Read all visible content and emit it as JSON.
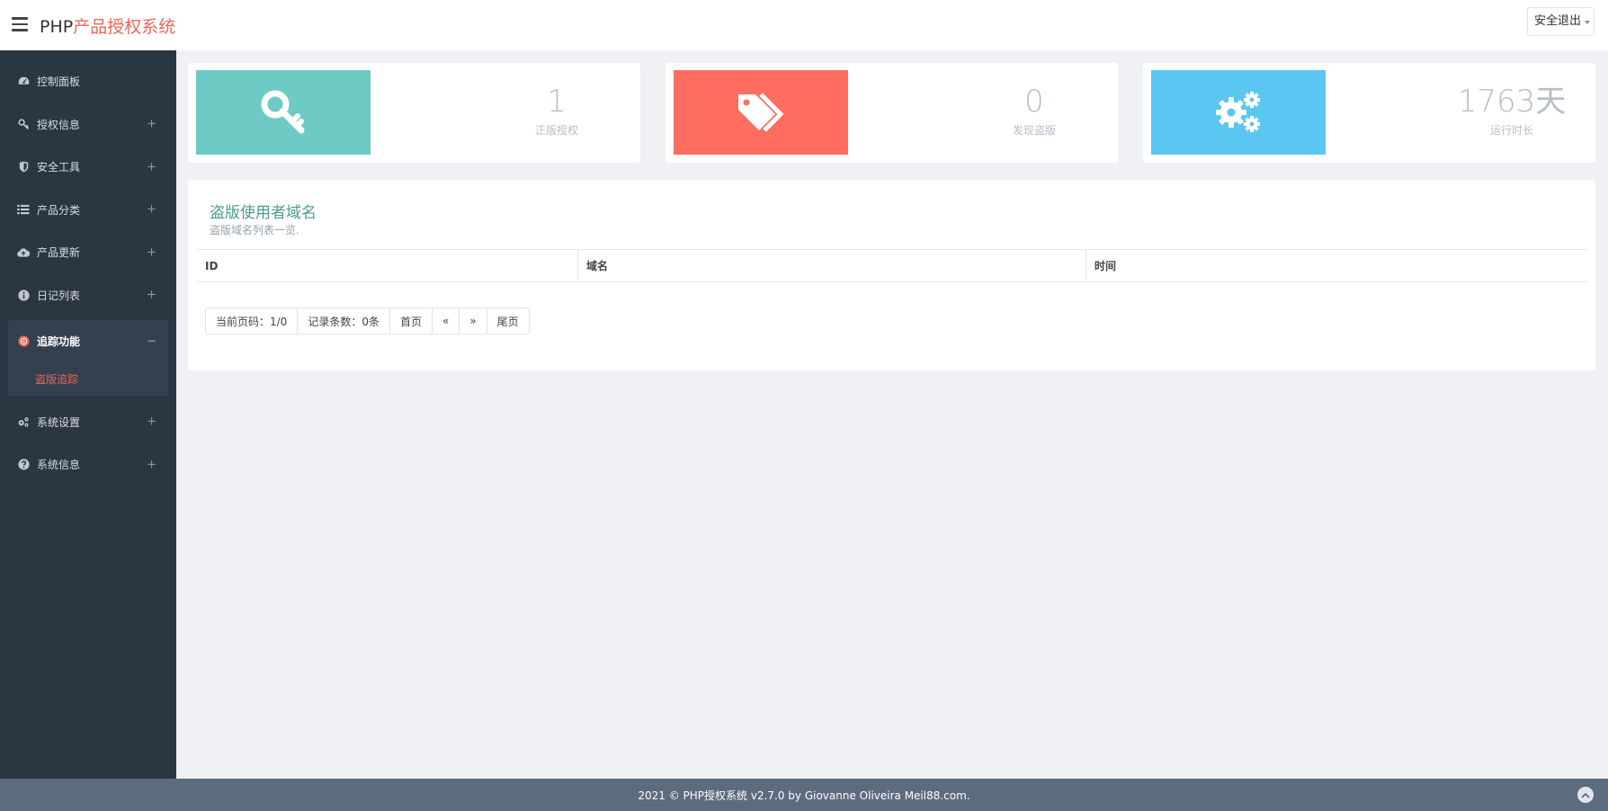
{
  "header": {
    "brand_prefix": "PHP",
    "brand_suffix": "产品授权系统",
    "logout_label": "安全退出"
  },
  "sidebar": {
    "items": [
      {
        "label": "控制面板",
        "icon": "dashboard-icon"
      },
      {
        "label": "授权信息",
        "icon": "key-icon",
        "toggle": "+"
      },
      {
        "label": "安全工具",
        "icon": "shield-icon",
        "toggle": "+"
      },
      {
        "label": "产品分类",
        "icon": "list-icon",
        "toggle": "+"
      },
      {
        "label": "产品更新",
        "icon": "cloud-upload-icon",
        "toggle": "+"
      },
      {
        "label": "日记列表",
        "icon": "info-icon",
        "toggle": "+"
      },
      {
        "label": "追踪功能",
        "icon": "target-icon",
        "toggle": "−",
        "active": true
      },
      {
        "label": "系统设置",
        "icon": "gears-icon",
        "toggle": "+"
      },
      {
        "label": "系统信息",
        "icon": "question-icon",
        "toggle": "+"
      }
    ],
    "active_sub": "盗版追踪"
  },
  "stats": [
    {
      "value": "1",
      "label": "正版授权",
      "color": "#6ecac4",
      "icon": "key-icon"
    },
    {
      "value": "0",
      "label": "发现盗版",
      "color": "#ff6d60",
      "icon": "tags-icon"
    },
    {
      "value": "1763天",
      "label": "运行时长",
      "color": "#5bc6f2",
      "icon": "gears-icon"
    }
  ],
  "panel": {
    "title": "盗版使用者域名",
    "subtitle": "盗版域名列表一览.",
    "columns": [
      "ID",
      "域名",
      "时间"
    ],
    "pager": {
      "current": "当前页码：1/0",
      "count": "记录条数：0条",
      "first": "首页",
      "prev": "«",
      "next": "»",
      "last": "尾页"
    }
  },
  "footer": {
    "text": "2021 © PHP授权系统 v2.7.0 by Giovanne Oliveira Meil88.com."
  }
}
